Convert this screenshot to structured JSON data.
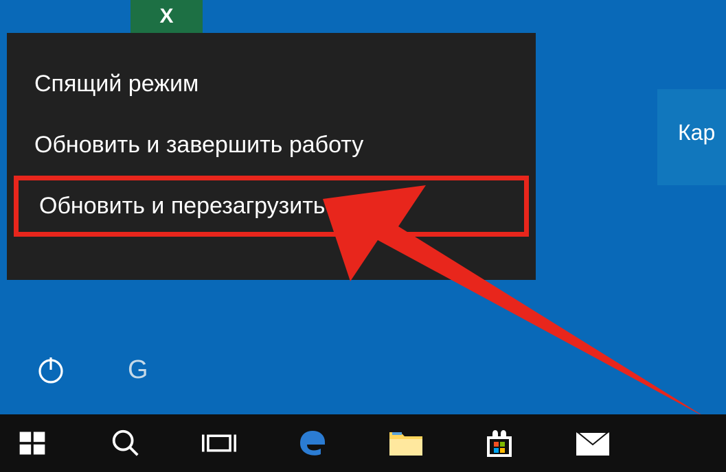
{
  "tile": {
    "excel": "X",
    "label": "Кар"
  },
  "powerMenu": {
    "items": [
      {
        "label": "Спящий режим",
        "highlighted": false
      },
      {
        "label": "Обновить и завершить работу",
        "highlighted": false
      },
      {
        "label": "Обновить и перезагрузить",
        "highlighted": true
      }
    ]
  },
  "startArea": {
    "g": "G"
  },
  "colors": {
    "highlight": "#e8261c",
    "desktop": "#0969b8",
    "menu": "#212121"
  }
}
